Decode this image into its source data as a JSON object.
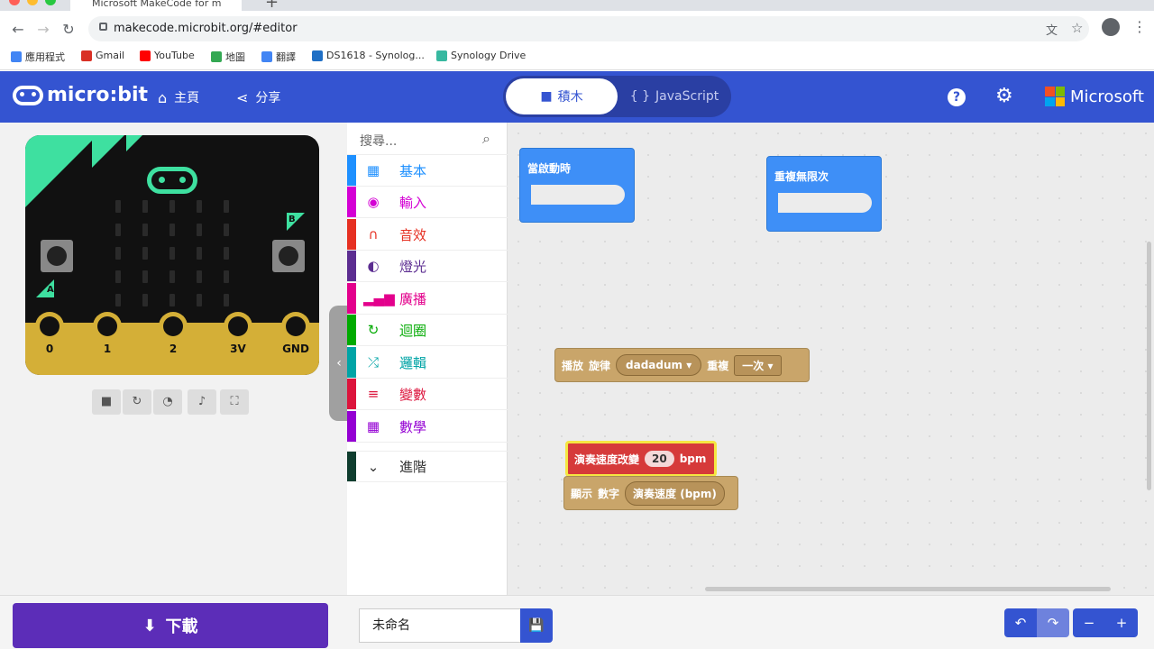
{
  "browser": {
    "tab_title": "Microsoft MakeCode for m",
    "url": "makecode.microbit.org/#editor",
    "bookmarks": [
      {
        "label": "應用程式",
        "icon": "apps-grid-icon",
        "color": "#4285f4"
      },
      {
        "label": "Gmail",
        "icon": "gmail-icon",
        "color": "#d93025"
      },
      {
        "label": "YouTube",
        "icon": "youtube-icon",
        "color": "#ff0000"
      },
      {
        "label": "地圖",
        "icon": "maps-icon",
        "color": "#34a853"
      },
      {
        "label": "翻譯",
        "icon": "translate-icon",
        "color": "#4285f4"
      },
      {
        "label": "DS1618 - Synolog...",
        "icon": "dsm-icon",
        "color": "#1f6fc5"
      },
      {
        "label": "Synology Drive",
        "icon": "synology-drive-icon",
        "color": "#37b8a0"
      }
    ]
  },
  "header": {
    "logo": "micro:bit",
    "home_label": "主頁",
    "share_label": "分享",
    "blocks_label": "積木",
    "javascript_label": "JavaScript",
    "brand": "Microsoft",
    "accent": "#3454d1"
  },
  "simulator": {
    "pins": [
      "0",
      "1",
      "2",
      "3V",
      "GND"
    ],
    "button_a": "A",
    "button_b": "B",
    "controls": [
      "stop-icon",
      "restart-icon",
      "slowmo-icon",
      "sound-icon",
      "fullscreen-icon"
    ]
  },
  "toolbox": {
    "search_placeholder": "搜尋...",
    "categories": [
      {
        "label": "基本",
        "color": "#1e90ff",
        "icon": "grid-icon"
      },
      {
        "label": "輸入",
        "color": "#d400d4",
        "icon": "target-icon"
      },
      {
        "label": "音效",
        "color": "#e63022",
        "icon": "headphones-icon"
      },
      {
        "label": "燈光",
        "color": "#5c2d91",
        "icon": "toggle-icon"
      },
      {
        "label": "廣播",
        "color": "#e3008c",
        "icon": "signal-icon"
      },
      {
        "label": "迴圈",
        "color": "#00aa00",
        "icon": "loop-icon"
      },
      {
        "label": "邏輯",
        "color": "#00a4a6",
        "icon": "shuffle-icon"
      },
      {
        "label": "變數",
        "color": "#dc143c",
        "icon": "lines-icon"
      },
      {
        "label": "數學",
        "color": "#9400d3",
        "icon": "calculator-icon"
      }
    ],
    "advanced": "進階"
  },
  "workspace": {
    "on_start": "當啟動時",
    "forever": "重複無限次",
    "play_melody": {
      "play": "播放",
      "melody": "旋律",
      "melody_value": "dadadum",
      "repeat": "重複",
      "repeat_value": "一次"
    },
    "set_tempo": {
      "label": "演奏速度改變",
      "value": "20",
      "unit": "bpm"
    },
    "show_number": {
      "label1": "顯示",
      "label2": "數字",
      "arg": "演奏速度 (bpm)"
    }
  },
  "footer": {
    "download": "下載",
    "project_name": "未命名"
  }
}
